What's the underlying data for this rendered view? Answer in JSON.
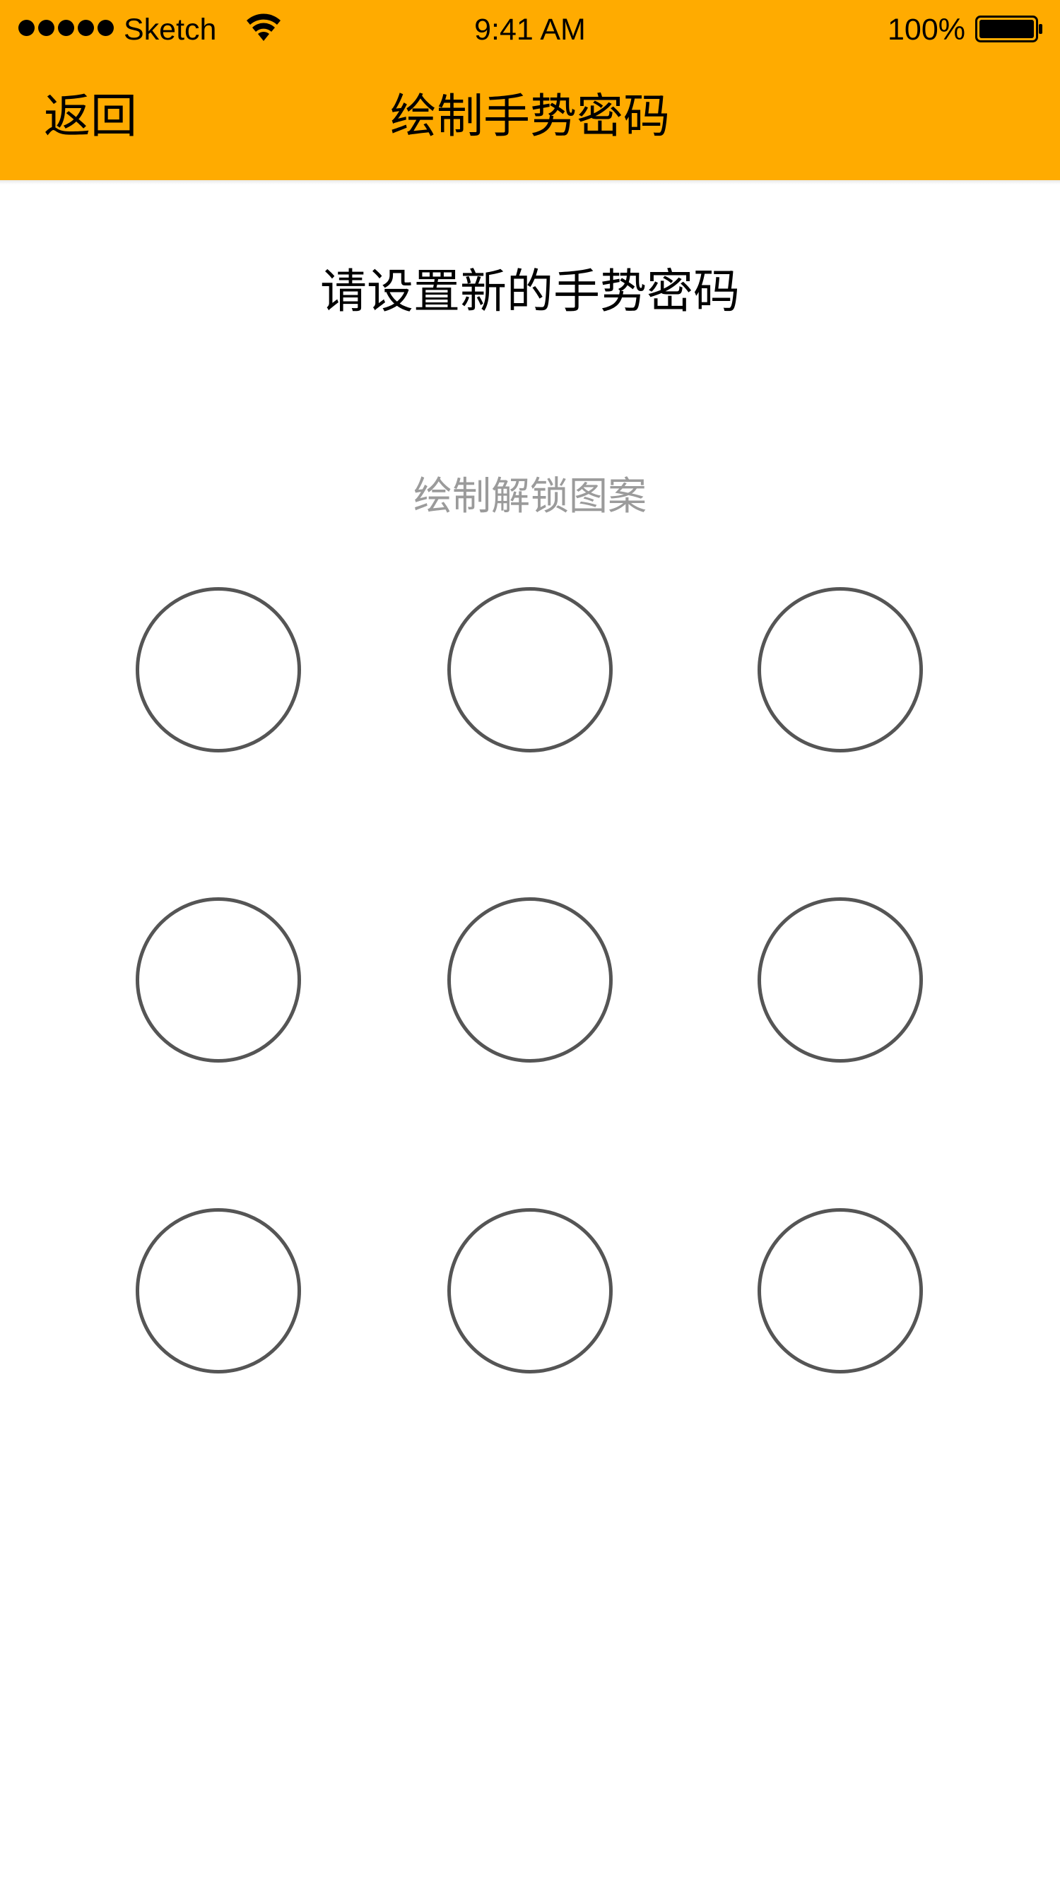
{
  "status_bar": {
    "carrier": "Sketch",
    "time": "9:41 AM",
    "battery_percent": "100%",
    "signal_icon": "signal-dots-icon",
    "wifi_icon": "wifi-icon",
    "battery_icon": "battery-full-icon"
  },
  "nav_bar": {
    "back_label": "返回",
    "title": "绘制手势密码",
    "background_color": "#ffab00"
  },
  "content": {
    "prompt": "请设置新的手势密码",
    "hint": "绘制解锁图案"
  },
  "pattern_lock": {
    "rows": 3,
    "columns": 3,
    "dots": [
      {
        "row": 1,
        "col": 1,
        "selected": false
      },
      {
        "row": 1,
        "col": 2,
        "selected": false
      },
      {
        "row": 1,
        "col": 3,
        "selected": false
      },
      {
        "row": 2,
        "col": 1,
        "selected": false
      },
      {
        "row": 2,
        "col": 2,
        "selected": false
      },
      {
        "row": 2,
        "col": 3,
        "selected": false
      },
      {
        "row": 3,
        "col": 1,
        "selected": false
      },
      {
        "row": 3,
        "col": 2,
        "selected": false
      },
      {
        "row": 3,
        "col": 3,
        "selected": false
      }
    ],
    "ring_color": "#555555"
  }
}
